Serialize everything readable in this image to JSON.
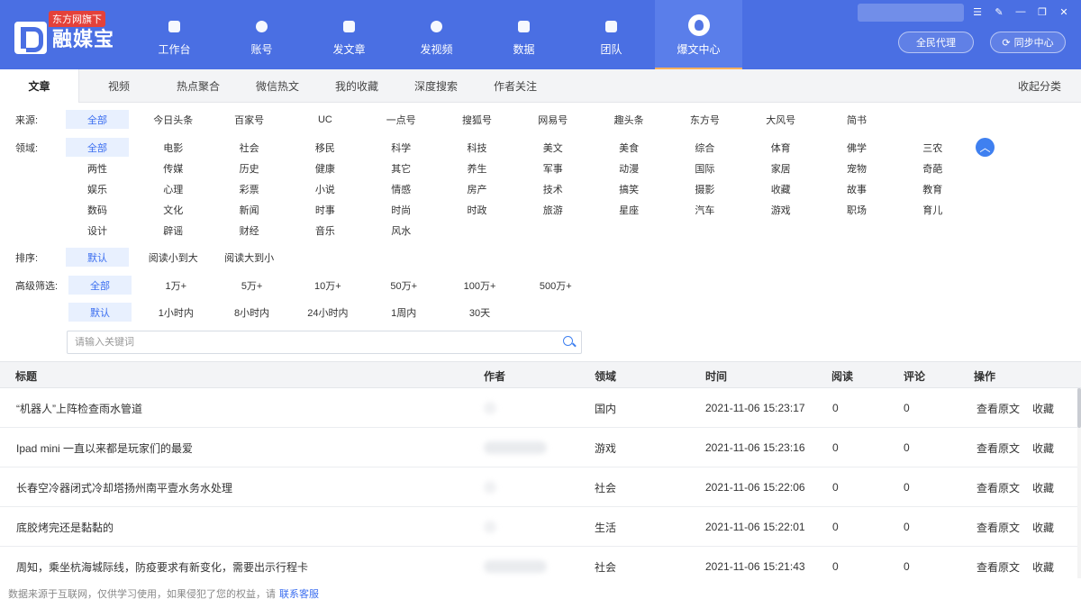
{
  "app": {
    "badge": "东方网旗下",
    "name": "融媒宝"
  },
  "nav": [
    {
      "label": "工作台",
      "icon": "monitor-icon"
    },
    {
      "label": "账号",
      "icon": "user-icon"
    },
    {
      "label": "发文章",
      "icon": "feather-icon"
    },
    {
      "label": "发视频",
      "icon": "play-icon"
    },
    {
      "label": "数据",
      "icon": "chart-icon"
    },
    {
      "label": "团队",
      "icon": "team-icon"
    },
    {
      "label": "爆文中心",
      "icon": "flame-icon",
      "active": true
    }
  ],
  "header": {
    "agent_button": "全民代理",
    "sync_button": "同步中心"
  },
  "window_controls": [
    "menu-icon",
    "edit-icon",
    "minimize-icon",
    "restore-icon",
    "close-icon"
  ],
  "tabs": [
    "文章",
    "视频",
    "热点聚合",
    "微信热文",
    "我的收藏",
    "深度搜索",
    "作者关注"
  ],
  "tab_collapse": "收起分类",
  "filters": {
    "source_label": "来源:",
    "sources": [
      "全部",
      "今日头条",
      "百家号",
      "UC",
      "一点号",
      "搜狐号",
      "网易号",
      "趣头条",
      "东方号",
      "大风号",
      "简书"
    ],
    "domain_label": "领域:",
    "domains": [
      [
        "全部",
        "电影",
        "社会",
        "移民",
        "科学",
        "科技",
        "美文",
        "美食",
        "综合",
        "体育",
        "佛学",
        "三农"
      ],
      [
        "两性",
        "传媒",
        "历史",
        "健康",
        "其它",
        "养生",
        "军事",
        "动漫",
        "国际",
        "家居",
        "宠物",
        "奇葩"
      ],
      [
        "娱乐",
        "心理",
        "彩票",
        "小说",
        "情感",
        "房产",
        "技术",
        "搞笑",
        "摄影",
        "收藏",
        "故事",
        "教育"
      ],
      [
        "数码",
        "文化",
        "新闻",
        "时事",
        "时尚",
        "时政",
        "旅游",
        "星座",
        "汽车",
        "游戏",
        "职场",
        "育儿"
      ],
      [
        "设计",
        "辟谣",
        "财经",
        "音乐",
        "风水"
      ]
    ],
    "sort_label": "排序:",
    "sorts": [
      "默认",
      "阅读小到大",
      "阅读大到小"
    ],
    "advanced_label": "高级筛选:",
    "reads": [
      "全部",
      "1万+",
      "5万+",
      "10万+",
      "50万+",
      "100万+",
      "500万+"
    ],
    "times": [
      "默认",
      "1小时内",
      "8小时内",
      "24小时内",
      "1周内",
      "30天"
    ]
  },
  "search": {
    "placeholder": "请输入关键词"
  },
  "table": {
    "headers": {
      "title": "标题",
      "author": "作者",
      "domain": "领域",
      "time": "时间",
      "reads": "阅读",
      "comments": "评论",
      "actions": "操作"
    },
    "view_label": "查看原文",
    "fav_label": "收藏",
    "rows": [
      {
        "title": "“机器人”上阵检查雨水管道",
        "domain": "国内",
        "time": "2021-11-06 15:23:17",
        "reads": "0",
        "comments": "0",
        "author_width": "short"
      },
      {
        "title": "Ipad mini 一直以来都是玩家们的最爱",
        "domain": "游戏",
        "time": "2021-11-06 15:23:16",
        "reads": "0",
        "comments": "0",
        "author_width": "long"
      },
      {
        "title": "长春空冷器闭式冷却塔扬州南平壹水务水处理",
        "domain": "社会",
        "time": "2021-11-06 15:22:06",
        "reads": "0",
        "comments": "0",
        "author_width": "short"
      },
      {
        "title": "底胶烤完还是黏黏的",
        "domain": "生活",
        "time": "2021-11-06 15:22:01",
        "reads": "0",
        "comments": "0",
        "author_width": "short"
      },
      {
        "title": "周知，乘坐杭海城际线，防疫要求有新变化，需要出示行程卡",
        "domain": "社会",
        "time": "2021-11-06 15:21:43",
        "reads": "0",
        "comments": "0",
        "author_width": "long"
      }
    ]
  },
  "footer": {
    "text": "数据来源于互联网，仅供学习使用，如果侵犯了您的权益，请",
    "link": "联系客服"
  }
}
